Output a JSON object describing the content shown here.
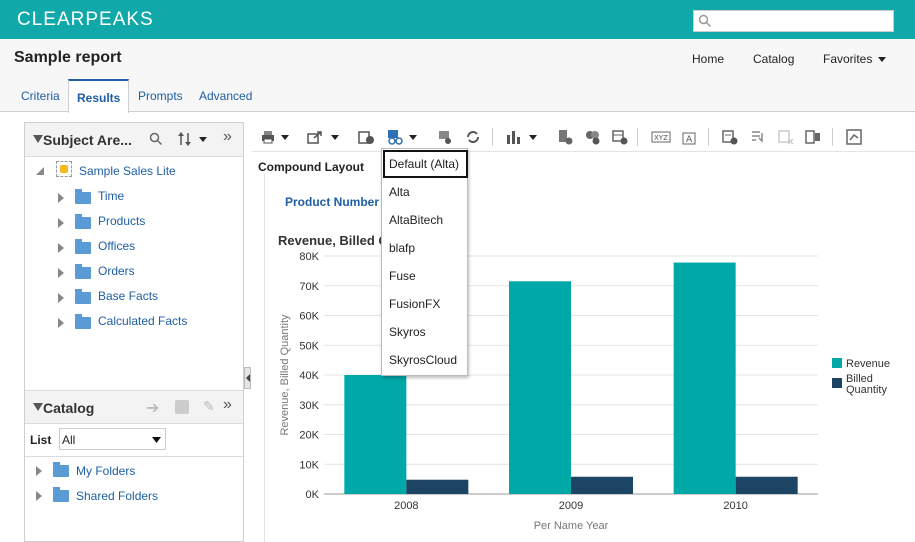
{
  "brand": {
    "logo_text": "CLEARPEAKS",
    "color": "#10a8a8"
  },
  "search": {
    "placeholder": "",
    "icon": "search-icon"
  },
  "header": {
    "page_title": "Sample report",
    "nav": {
      "home": "Home",
      "catalog": "Catalog",
      "favorites": "Favorites"
    }
  },
  "tabs": [
    {
      "label": "Criteria"
    },
    {
      "label": "Results"
    },
    {
      "label": "Prompts"
    },
    {
      "label": "Advanced"
    }
  ],
  "subject_area": {
    "title": "Subject Are...",
    "root": "Sample Sales Lite",
    "items": [
      "Time",
      "Products",
      "Offices",
      "Orders",
      "Base Facts",
      "Calculated Facts"
    ]
  },
  "catalog": {
    "title": "Catalog",
    "list_label": "List",
    "list_value": "All",
    "items": [
      "My Folders",
      "Shared Folders"
    ]
  },
  "compound_layout": "Compound Layout",
  "product_number": "Product Number",
  "style_menu": {
    "items": [
      "Default (Alta)",
      "Alta",
      "AltaBitech",
      "blafp",
      "Fuse",
      "FusionFX",
      "Skyros",
      "SkyrosCloud"
    ],
    "selected": "Default (Alta)"
  },
  "chart_data": {
    "type": "bar",
    "title": "Revenue, Billed Q",
    "xlabel": "Per Name Year",
    "ylabel": "Revenue, Billed Quantity",
    "categories": [
      "2008",
      "2009",
      "2010"
    ],
    "series": [
      {
        "name": "Revenue",
        "color": "#00a8a8",
        "values": [
          40000,
          71500,
          77800
        ]
      },
      {
        "name": "Billed Quantity",
        "color": "#1c4463",
        "values": [
          4800,
          5800,
          5800
        ]
      }
    ],
    "ylim": [
      0,
      80000
    ],
    "yticks": [
      "0K",
      "10K",
      "20K",
      "30K",
      "40K",
      "50K",
      "60K",
      "70K",
      "80K"
    ],
    "grid": true,
    "legend": "right"
  }
}
